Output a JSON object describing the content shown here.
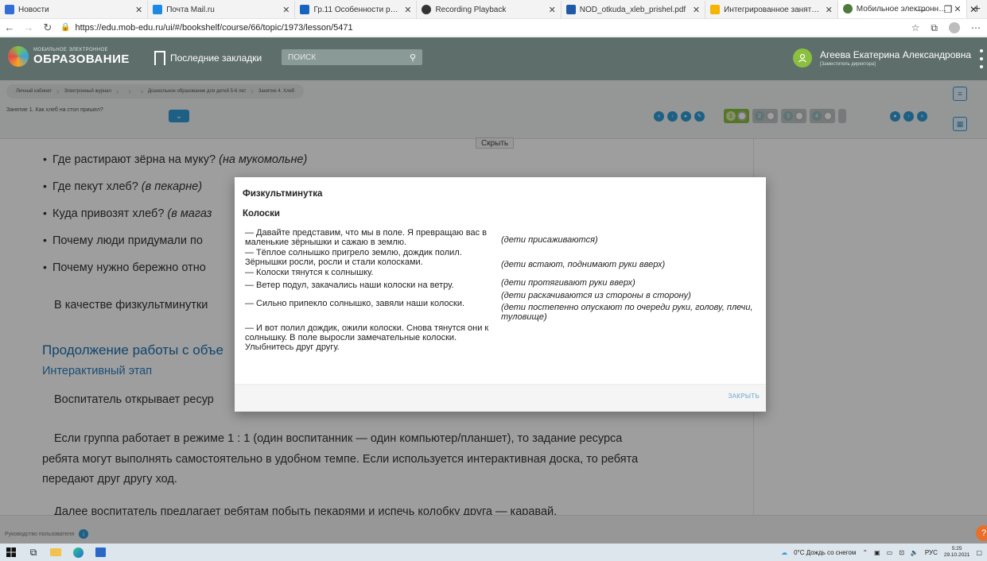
{
  "browser": {
    "tabs": [
      {
        "title": "Новости",
        "color": "#2f6fd6",
        "active": false
      },
      {
        "title": "Почта Mail.ru",
        "color": "#1e88e5",
        "active": false
      },
      {
        "title": "Гр.11 Особенности реализаци",
        "color": "#1565c0",
        "active": false
      },
      {
        "title": "Recording Playback",
        "color": "#333333",
        "active": false
      },
      {
        "title": "NOD_otkuda_xleb_prishel.pdf",
        "color": "#1e5aa8",
        "active": false
      },
      {
        "title": "Интегрированное занятие по с",
        "color": "#f5b400",
        "active": false
      },
      {
        "title": "Мобильное электронное обра",
        "color": "#4e7a3c",
        "active": true
      }
    ],
    "url": "https://edu.mob-edu.ru/ui/#/bookshelf/course/66/topic/1973/lesson/5471"
  },
  "header": {
    "logo_small": "МОБИЛЬНОЕ ЭЛЕКТРОННОЕ",
    "logo_big": "ОБРАЗОВАНИЕ",
    "bookmarks_label": "Последние закладки",
    "search_placeholder": "поиск",
    "user_name": "Агеева Екатерина Александровна",
    "user_role": "[Заместитель директора]"
  },
  "breadcrumb": [
    "Личный кабинет",
    "Электронный журнал",
    "",
    "",
    "Дошкольное образование для детей 5-6 лет",
    "Занятие 4. Хлеб"
  ],
  "lesson_select": "Занятие 1. Как хлеб на стол пришел?",
  "toolbar": {
    "hide_label": "Скрыть",
    "segments": [
      "1",
      "2",
      "3",
      "4"
    ]
  },
  "content": {
    "bullets": [
      {
        "q": "Где растирают зёрна на муку? ",
        "a": "(на мукомольне)"
      },
      {
        "q": "Где пекут хлеб? ",
        "a": "(в пекарне)"
      },
      {
        "q": "Куда привозят хлеб? ",
        "a": "(в магаз"
      },
      {
        "q": "Почему люди придумали по",
        "a": ""
      },
      {
        "q": "Почему нужно бережно отно",
        "a": ""
      }
    ],
    "para_fizkult": "В качестве физкультминутки",
    "section_title": "Продолжение работы с объе",
    "section_sub": "Интерактивный этап",
    "para_open": "Воспитатель открывает ресур",
    "para_mode_1": "Если группа работает в режиме 1 : 1 (один воспитанник — один компьютер/планшет), то задание ресурса",
    "para_mode_2": "ребята могут выполнять самостоятельно в удобном темпе. Если используется интерактивная доска, то ребята",
    "para_mode_3": "передают друг другу ход.",
    "para_next": "Далее воспитатель предлагает ребятам побыть пекарями и испечь колобку друга — каравай."
  },
  "modal": {
    "title": "Физкультминутка",
    "subtitle": "Колоски",
    "lines": [
      "— Давайте представим, что мы в поле. Я превращаю вас в маленькие зёрнышки и сажаю в землю.",
      "— Тёплое солнышко пригрело землю, дождик полил. Зёрнышки росли, росли и стали колосками.",
      "— Колоски тянутся к солнышку.",
      "— Ветер подул, закачались наши колоски на ветру.",
      "— Сильно припекло солнышко, завяли наши колоски.",
      "— И вот полил дождик, ожили колоски. Снова тянутся они к солнышку. В поле выросли замечательные колоски. Улыбнитесь друг другу."
    ],
    "notes": [
      "(дети присаживаются)",
      "(дети встают, поднимают руки вверх)",
      "(дети протягивают руки вверх)",
      "(дети раскачиваются из стороны в сторону)",
      "(дети постепенно опускают по очереди руки, голову, плечи, туловище)"
    ],
    "close_label": "ЗАКРЫТЬ"
  },
  "footer": {
    "manual_label": "Руководство пользователя"
  },
  "taskbar": {
    "weather": "0°C Дождь со снегом",
    "lang": "РУС",
    "time": "5:25",
    "date": "29.10.2021"
  },
  "colors": {
    "header_bg": "#5e6e6b",
    "accent_blue": "#2f9bd6",
    "accent_green": "#8bbf3f",
    "link_blue": "#1b6eae"
  }
}
